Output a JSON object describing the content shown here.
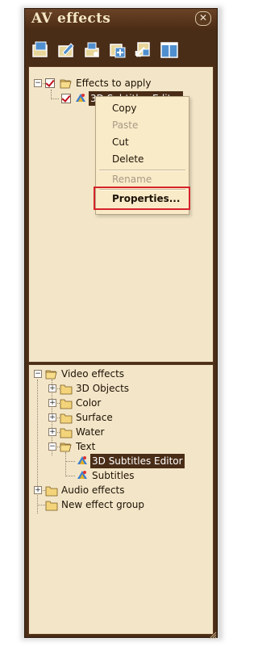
{
  "window": {
    "title": "AV effects",
    "close_glyph": "✕"
  },
  "toolbar": {
    "buttons": [
      {
        "name": "new-effect-icon"
      },
      {
        "name": "edit-effect-icon"
      },
      {
        "name": "export-icon"
      },
      {
        "name": "add-group-icon"
      },
      {
        "name": "move-icon"
      },
      {
        "name": "layout-icon"
      }
    ]
  },
  "top_tree": {
    "root": {
      "label": "Effects to apply",
      "expander": "−"
    },
    "child": {
      "label": "3D Subtitles Editor"
    }
  },
  "context_menu": {
    "items": [
      {
        "label": "Copy",
        "enabled": true
      },
      {
        "label": "Paste",
        "enabled": false
      },
      {
        "label": "Cut",
        "enabled": true
      },
      {
        "label": "Delete",
        "enabled": true
      },
      {
        "label": "Rename",
        "enabled": false
      },
      {
        "label": "Properties...",
        "enabled": true
      }
    ]
  },
  "bottom_tree": {
    "video_effects": {
      "label": "Video effects",
      "expander": "−"
    },
    "groups": [
      {
        "label": "3D Objects",
        "expander": "+"
      },
      {
        "label": "Color",
        "expander": "+"
      },
      {
        "label": "Surface",
        "expander": "+"
      },
      {
        "label": "Water",
        "expander": "+"
      },
      {
        "label": "Text",
        "expander": "−"
      }
    ],
    "text_children": [
      {
        "label": "3D Subtitles Editor",
        "selected": true
      },
      {
        "label": "Subtitles",
        "selected": false
      }
    ],
    "audio_effects": {
      "label": "Audio effects",
      "expander": "+"
    },
    "new_group": {
      "label": "New effect group"
    }
  },
  "colors": {
    "frame": "#4a2d17",
    "pane": "#f3e6c8",
    "highlight_box": "#d6242b",
    "check": "#c0101a"
  }
}
